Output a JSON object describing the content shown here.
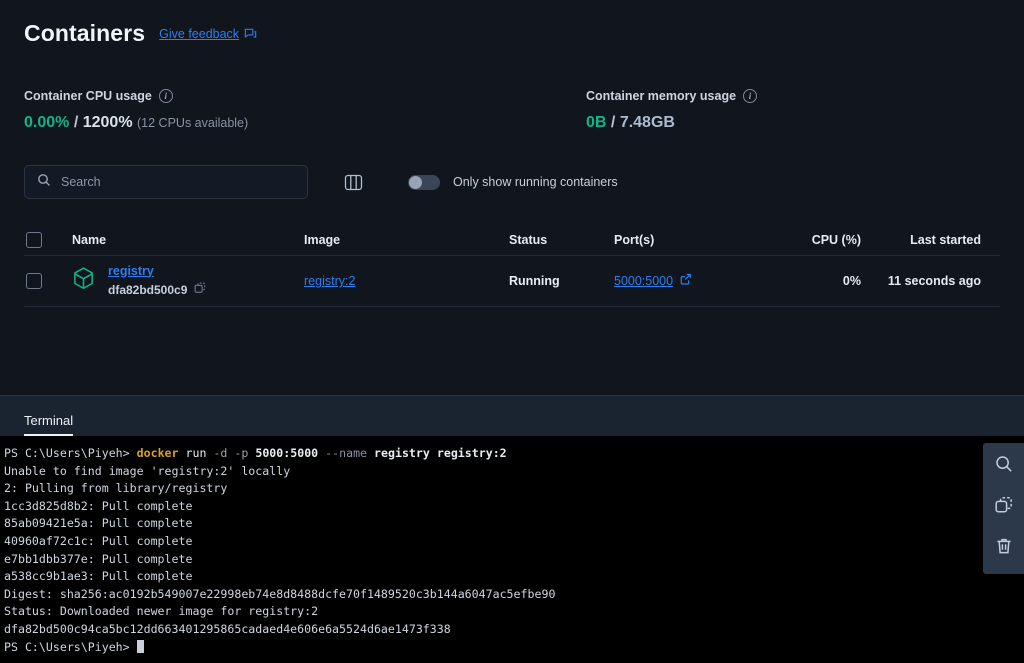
{
  "header": {
    "title": "Containers",
    "feedback_label": "Give feedback",
    "feedback_icon": "feedback-bubble-icon"
  },
  "stats": {
    "cpu": {
      "label": "Container CPU usage",
      "info_icon": "info-icon",
      "used": "0.00%",
      "separator": "/",
      "total": "1200%",
      "note": "(12 CPUs available)"
    },
    "memory": {
      "label": "Container memory usage",
      "info_icon": "info-icon",
      "used": "0B",
      "separator": "/",
      "total": "7.48GB"
    }
  },
  "controls": {
    "search_placeholder": "Search",
    "search_value": "",
    "search_icon": "search-icon",
    "columns_icon": "columns-layout-icon",
    "toggle_label": "Only show running containers",
    "toggle_on": false
  },
  "table": {
    "columns": [
      "Name",
      "Image",
      "Status",
      "Port(s)",
      "CPU (%)",
      "Last started"
    ],
    "rows": [
      {
        "name": "registry",
        "container_id": "dfa82bd500c9",
        "image": "registry:2",
        "status": "Running",
        "ports": "5000:5000",
        "cpu": "0%",
        "last_started": "11 seconds ago",
        "container_icon": "container-cube-icon",
        "copy_icon": "copy-icon",
        "external_link_icon": "external-link-icon"
      }
    ]
  },
  "terminal": {
    "tab_label": "Terminal",
    "prompt": "PS C:\\Users\\Piyeh>",
    "command": {
      "binary": "docker",
      "subcommand": "run",
      "flag_detach": "-d",
      "flag_publish": "-p",
      "publish_value": "5000:5000",
      "flag_name": "--name",
      "name_value": "registry",
      "image": "registry:2"
    },
    "output_lines": [
      "Unable to find image 'registry:2' locally",
      "2: Pulling from library/registry",
      "1cc3d825d8b2: Pull complete",
      "85ab09421e5a: Pull complete",
      "40960af72c1c: Pull complete",
      "e7bb1dbb377e: Pull complete",
      "a538cc9b1ae3: Pull complete",
      "Digest: sha256:ac0192b549007e22998eb74e8d8488dcfe70f1489520c3b144a6047ac5efbe90",
      "Status: Downloaded newer image for registry:2",
      "dfa82bd500c94ca5bc12dd663401295865cadaed4e606e6a5524d6ae1473f338"
    ],
    "final_prompt": "PS C:\\Users\\Piyeh>",
    "tools": [
      "search-icon",
      "copy-icon",
      "trash-icon"
    ]
  },
  "colors": {
    "accent_link": "#2f7ef0",
    "success_green": "#0fb686",
    "panel_bg": "#10151e",
    "terminal_bg": "#000000"
  }
}
